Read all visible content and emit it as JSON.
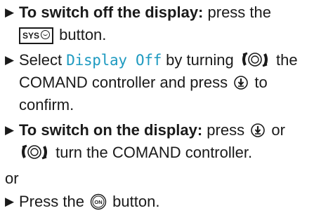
{
  "steps": [
    {
      "bold": "To switch off the display:",
      "text1": " press the",
      "key_label": "SYS",
      "text2": " button."
    },
    {
      "pre": "Select ",
      "highlight": "Display Off",
      "mid": " by turning",
      "tail": " the",
      "line2": "COMAND controller and press",
      "line2_tail": " to",
      "line3": "confirm."
    },
    {
      "bold": "To switch on the display:",
      "text1": " press",
      "text1_tail": " or",
      "line2": " turn the COMAND controller."
    }
  ],
  "or_text": "or",
  "last_step": {
    "pre": "Press the",
    "post": " button."
  },
  "icons": {
    "arrow": "▶",
    "sys_button": "sys-button-icon",
    "controller_turn": "controller-turn-icon",
    "controller_press": "controller-press-icon",
    "on_button": "on-button-icon"
  },
  "colors": {
    "text": "#1a1a1a",
    "highlight": "#1e9ac0"
  }
}
